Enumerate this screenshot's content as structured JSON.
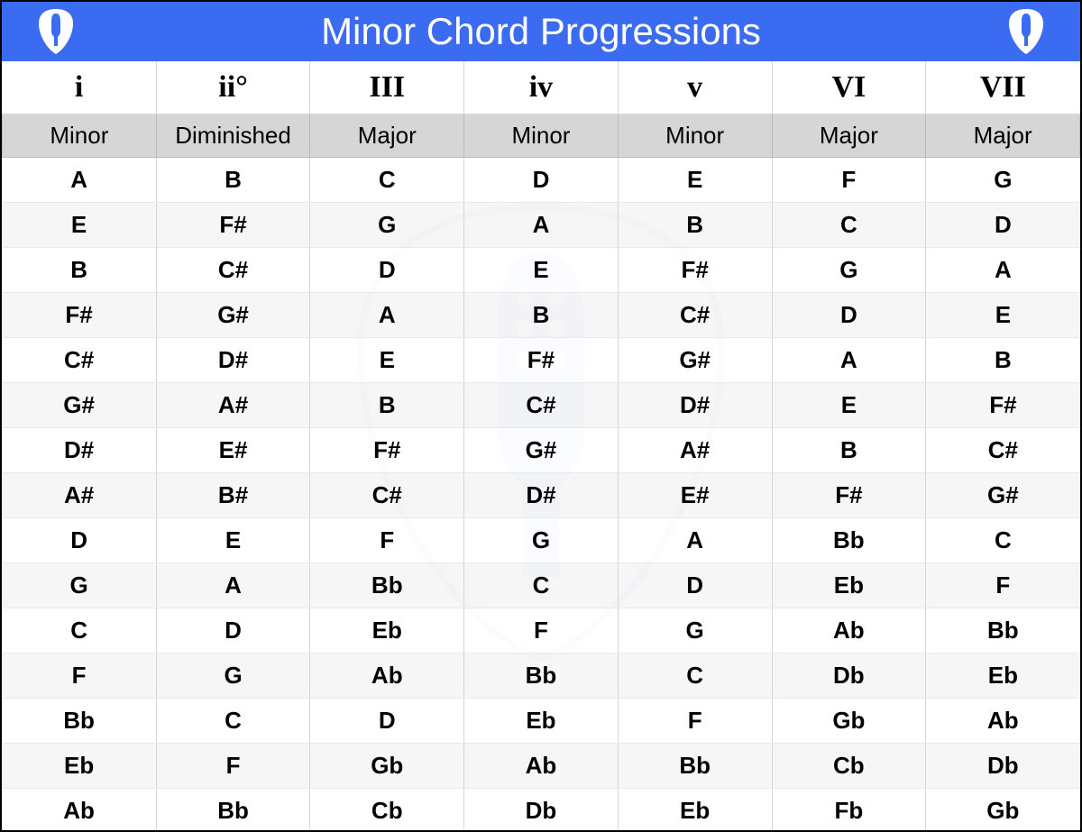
{
  "title": "Minor Chord Progressions",
  "columns": {
    "roman": [
      "i",
      "ii°",
      "III",
      "iv",
      "v",
      "VI",
      "VII"
    ],
    "quality": [
      "Minor",
      "Diminished",
      "Major",
      "Minor",
      "Minor",
      "Major",
      "Major"
    ]
  },
  "rows": [
    [
      "A",
      "B",
      "C",
      "D",
      "E",
      "F",
      "G"
    ],
    [
      "E",
      "F#",
      "G",
      "A",
      "B",
      "C",
      "D"
    ],
    [
      "B",
      "C#",
      "D",
      "E",
      "F#",
      "G",
      "A"
    ],
    [
      "F#",
      "G#",
      "A",
      "B",
      "C#",
      "D",
      "E"
    ],
    [
      "C#",
      "D#",
      "E",
      "F#",
      "G#",
      "A",
      "B"
    ],
    [
      "G#",
      "A#",
      "B",
      "C#",
      "D#",
      "E",
      "F#"
    ],
    [
      "D#",
      "E#",
      "F#",
      "G#",
      "A#",
      "B",
      "C#"
    ],
    [
      "A#",
      "B#",
      "C#",
      "D#",
      "E#",
      "F#",
      "G#"
    ],
    [
      "D",
      "E",
      "F",
      "G",
      "A",
      "Bb",
      "C"
    ],
    [
      "G",
      "A",
      "Bb",
      "C",
      "D",
      "Eb",
      "F"
    ],
    [
      "C",
      "D",
      "Eb",
      "F",
      "G",
      "Ab",
      "Bb"
    ],
    [
      "F",
      "G",
      "Ab",
      "Bb",
      "C",
      "Db",
      "Eb"
    ],
    [
      "Bb",
      "C",
      "D",
      "Eb",
      "F",
      "Gb",
      "Ab"
    ],
    [
      "Eb",
      "F",
      "Gb",
      "Ab",
      "Bb",
      "Cb",
      "Db"
    ],
    [
      "Ab",
      "Bb",
      "Cb",
      "Db",
      "Eb",
      "Fb",
      "Gb"
    ]
  ],
  "chart_data": {
    "type": "table",
    "title": "Minor Chord Progressions",
    "degree_roman_numerals": [
      "i",
      "ii°",
      "III",
      "iv",
      "v",
      "VI",
      "VII"
    ],
    "degree_chord_quality": [
      "Minor",
      "Diminished",
      "Major",
      "Minor",
      "Minor",
      "Major",
      "Major"
    ],
    "keys": [
      {
        "tonic": "A",
        "chords": [
          "A",
          "B",
          "C",
          "D",
          "E",
          "F",
          "G"
        ]
      },
      {
        "tonic": "E",
        "chords": [
          "E",
          "F#",
          "G",
          "A",
          "B",
          "C",
          "D"
        ]
      },
      {
        "tonic": "B",
        "chords": [
          "B",
          "C#",
          "D",
          "E",
          "F#",
          "G",
          "A"
        ]
      },
      {
        "tonic": "F#",
        "chords": [
          "F#",
          "G#",
          "A",
          "B",
          "C#",
          "D",
          "E"
        ]
      },
      {
        "tonic": "C#",
        "chords": [
          "C#",
          "D#",
          "E",
          "F#",
          "G#",
          "A",
          "B"
        ]
      },
      {
        "tonic": "G#",
        "chords": [
          "G#",
          "A#",
          "B",
          "C#",
          "D#",
          "E",
          "F#"
        ]
      },
      {
        "tonic": "D#",
        "chords": [
          "D#",
          "E#",
          "F#",
          "G#",
          "A#",
          "B",
          "C#"
        ]
      },
      {
        "tonic": "A#",
        "chords": [
          "A#",
          "B#",
          "C#",
          "D#",
          "E#",
          "F#",
          "G#"
        ]
      },
      {
        "tonic": "D",
        "chords": [
          "D",
          "E",
          "F",
          "G",
          "A",
          "Bb",
          "C"
        ]
      },
      {
        "tonic": "G",
        "chords": [
          "G",
          "A",
          "Bb",
          "C",
          "D",
          "Eb",
          "F"
        ]
      },
      {
        "tonic": "C",
        "chords": [
          "C",
          "D",
          "Eb",
          "F",
          "G",
          "Ab",
          "Bb"
        ]
      },
      {
        "tonic": "F",
        "chords": [
          "F",
          "G",
          "Ab",
          "Bb",
          "C",
          "Db",
          "Eb"
        ]
      },
      {
        "tonic": "Bb",
        "chords": [
          "Bb",
          "C",
          "D",
          "Eb",
          "F",
          "Gb",
          "Ab"
        ]
      },
      {
        "tonic": "Eb",
        "chords": [
          "Eb",
          "F",
          "Gb",
          "Ab",
          "Bb",
          "Cb",
          "Db"
        ]
      },
      {
        "tonic": "Ab",
        "chords": [
          "Ab",
          "Bb",
          "Cb",
          "Db",
          "Eb",
          "Fb",
          "Gb"
        ]
      }
    ]
  }
}
